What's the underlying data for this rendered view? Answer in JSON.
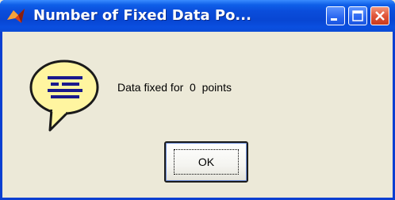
{
  "window": {
    "title": "Number of Fixed Data Po...",
    "icon": "matlab-icon",
    "controls": {
      "minimize_icon": "minimize-icon",
      "maximize_icon": "maximize-icon",
      "close_icon": "close-icon"
    }
  },
  "dialog": {
    "icon": "help-speech-bubble-icon",
    "message": "Data fixed for  0  points",
    "ok_label": "OK"
  },
  "colors": {
    "titlebar": "#0a4ddb",
    "dialog_bg": "#ece9d8",
    "close_button": "#e0553a",
    "bubble_fill": "#fff5a0",
    "bubble_lines": "#1a1a8c"
  }
}
